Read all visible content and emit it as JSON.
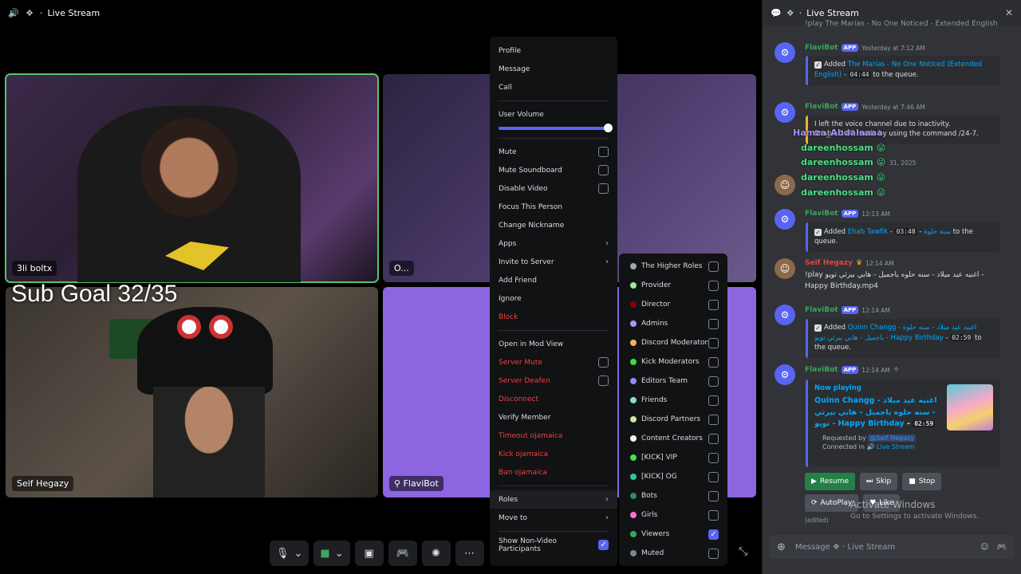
{
  "header": {
    "channel": "Live Stream"
  },
  "tiles": [
    {
      "label": "3li boltx"
    },
    {
      "label": "O..."
    },
    {
      "label": "Seif Hegazy"
    },
    {
      "label": "FlaviBot"
    }
  ],
  "overlay": {
    "sub_goal": "Sub Goal 32/35"
  },
  "context_menu": {
    "items_top": [
      "Profile",
      "Message",
      "Call"
    ],
    "volume_label": "User Volume",
    "toggles": [
      "Mute",
      "Mute Soundboard",
      "Disable Video"
    ],
    "actions": [
      "Focus This Person",
      "Change Nickname"
    ],
    "apps": "Apps",
    "invite": "Invite to Server",
    "add_friend": "Add Friend",
    "ignore": "Ignore",
    "block": "Block",
    "mod_view": "Open in Mod View",
    "server_mute": "Server Mute",
    "server_deafen": "Server Deafen",
    "disconnect": "Disconnect",
    "verify": "Verify Member",
    "timeout": "Timeout ojamaica",
    "kick": "Kick ojamaica",
    "ban": "Ban ojamaica",
    "roles": "Roles",
    "move_to": "Move to",
    "show_non_video": "Show Non-Video Participants"
  },
  "roles": [
    {
      "name": "The Higher Roles",
      "color": "#99aab5",
      "checked": false
    },
    {
      "name": "Provider",
      "color": "#a3e4a0",
      "checked": false
    },
    {
      "name": "Director",
      "color": "#8b0000",
      "checked": false
    },
    {
      "name": "Admins",
      "color": "#a89cf0",
      "checked": false
    },
    {
      "name": "Discord Moderators",
      "color": "#f0b35a",
      "checked": false
    },
    {
      "name": "Kick Moderators",
      "color": "#3ddc3d",
      "checked": false
    },
    {
      "name": "Editors Team",
      "color": "#8c8cff",
      "checked": false
    },
    {
      "name": "Friends",
      "color": "#7fe0c9",
      "checked": false
    },
    {
      "name": "Discord Partners",
      "color": "#c8e6a0",
      "checked": false
    },
    {
      "name": "Content Creators",
      "color": "#f5f5f5",
      "checked": false
    },
    {
      "name": "[KICK] VIP",
      "color": "#49e04f",
      "checked": false
    },
    {
      "name": "[KICK] OG",
      "color": "#2fc7a0",
      "checked": false
    },
    {
      "name": "Bots",
      "color": "#2e8b57",
      "checked": false
    },
    {
      "name": "Girls",
      "color": "#ff6fd0",
      "checked": false
    },
    {
      "name": "Viewers",
      "color": "#3ba55c",
      "checked": true
    },
    {
      "name": "Muted",
      "color": "#80848e",
      "checked": false
    }
  ],
  "chat": {
    "title": "Live Stream",
    "top_cut": "!play The Marías - No One Noticed - Extended English",
    "bot_name": "FlaviBot",
    "app_tag": "APP",
    "m1_time": "Yesterday at 7:12 AM",
    "m1_added": "Added",
    "m1_song": "The Marías - No One Noticed (Extended English)",
    "m1_dur": "04:44",
    "m1_tail": "to the queue.",
    "m2_time": "Yesterday at 7:46 AM",
    "m2_line1": "I left the voice channel due to inactivity.",
    "m2_line2": "Enable 24/7 mode by using the command /24-7.",
    "overlay_names": [
      "Hamza_Abdalaaaa",
      "dareenhossam",
      "dareenhossam",
      "dareenhossam",
      "dareenhossam"
    ],
    "date_sep": "31, 2025",
    "m3_time": "12:13 AM",
    "m3_added": "Added",
    "m3_artist": "Ehab Tawfik",
    "m3_dur": "03:48",
    "m3_song": "سنة حلوة",
    "m3_tail": "to the queue.",
    "m4_user": "Seif Hegazy",
    "m4_time": "12:14 AM",
    "m4_text": "!play اغنيه عيد ميلاد - سنه حلوه ياجميل - هابي بيرثي تويو - Happy Birthday.mp4",
    "m5_time": "12:14 AM",
    "m5_added": "Added",
    "m5_song": "Quinn Changg - اغنيه عيد ميلاد - سنه حلوه ياجميل - هابي بيرثي تويو - Happy Birthday",
    "m5_dur": "02:59",
    "m5_tail": "to the queue.",
    "m6_time": "12:14 AM",
    "np_label": "Now playing",
    "np_song": "Quinn Changg - اغنيه عيد ميلاد - سنه حلوه ياجميل - هابي بيرثي تويو - Happy Birthday",
    "np_dur": "02:59",
    "np_req": "Requested by",
    "np_req_user": "@Seif Hegazy",
    "np_conn": "Connected in",
    "np_conn_ch": "Live Stream",
    "buttons": {
      "resume": "Resume",
      "skip": "Skip",
      "stop": "Stop",
      "autoplay": "AutoPlay",
      "like": "Like"
    },
    "edited": "(edited)",
    "composer_placeholder": "Message ❖ · Live Stream"
  },
  "watermark": {
    "line1": "Activate Windows",
    "line2": "Go to Settings to activate Windows."
  },
  "colors": {
    "accent": "#5865f2",
    "danger": "#f23f43",
    "bot_name": "#3ba55c"
  }
}
